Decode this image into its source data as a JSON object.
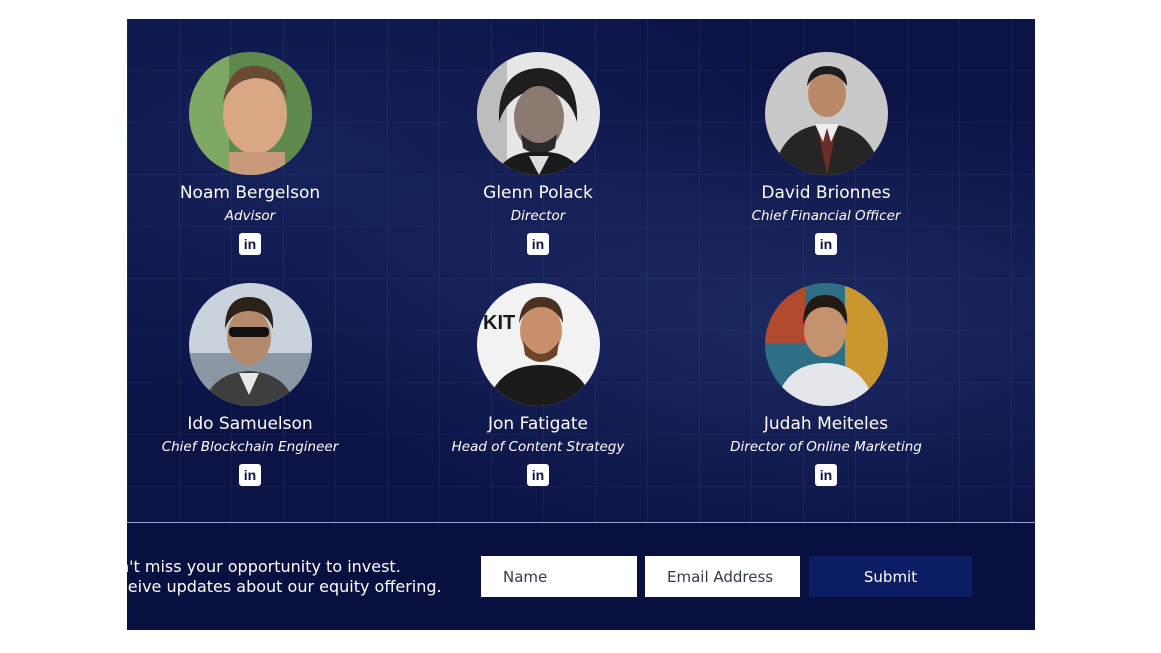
{
  "team": [
    {
      "name": "Noam Bergelson",
      "role": "Advisor",
      "social_icon": "linkedin-icon",
      "social_glyph": "in"
    },
    {
      "name": "Glenn Polack",
      "role": "Director",
      "social_icon": "linkedin-icon",
      "social_glyph": "in"
    },
    {
      "name": "David Brionnes",
      "role": "Chief Financial Officer",
      "social_icon": "linkedin-icon",
      "social_glyph": "in"
    },
    {
      "name": "Ido Samuelson",
      "role": "Chief Blockchain Engineer",
      "social_icon": "linkedin-icon",
      "social_glyph": "in"
    },
    {
      "name": "Jon Fatigate",
      "role": "Head of Content Strategy",
      "social_icon": "linkedin-icon",
      "social_glyph": "in"
    },
    {
      "name": "Judah Meiteles",
      "role": "Director of Online Marketing",
      "social_icon": "linkedin-icon",
      "social_glyph": "in"
    }
  ],
  "signup": {
    "line1": "n't miss your opportunity to invest.",
    "line2": "ceive updates about our equity offering.",
    "name_placeholder": "Name",
    "email_placeholder": "Email Address",
    "submit_label": "Submit"
  },
  "colors": {
    "background": "#0c1446",
    "signup_bar": "#07103f",
    "submit_button": "#0b1d63",
    "text": "#ffffff"
  }
}
